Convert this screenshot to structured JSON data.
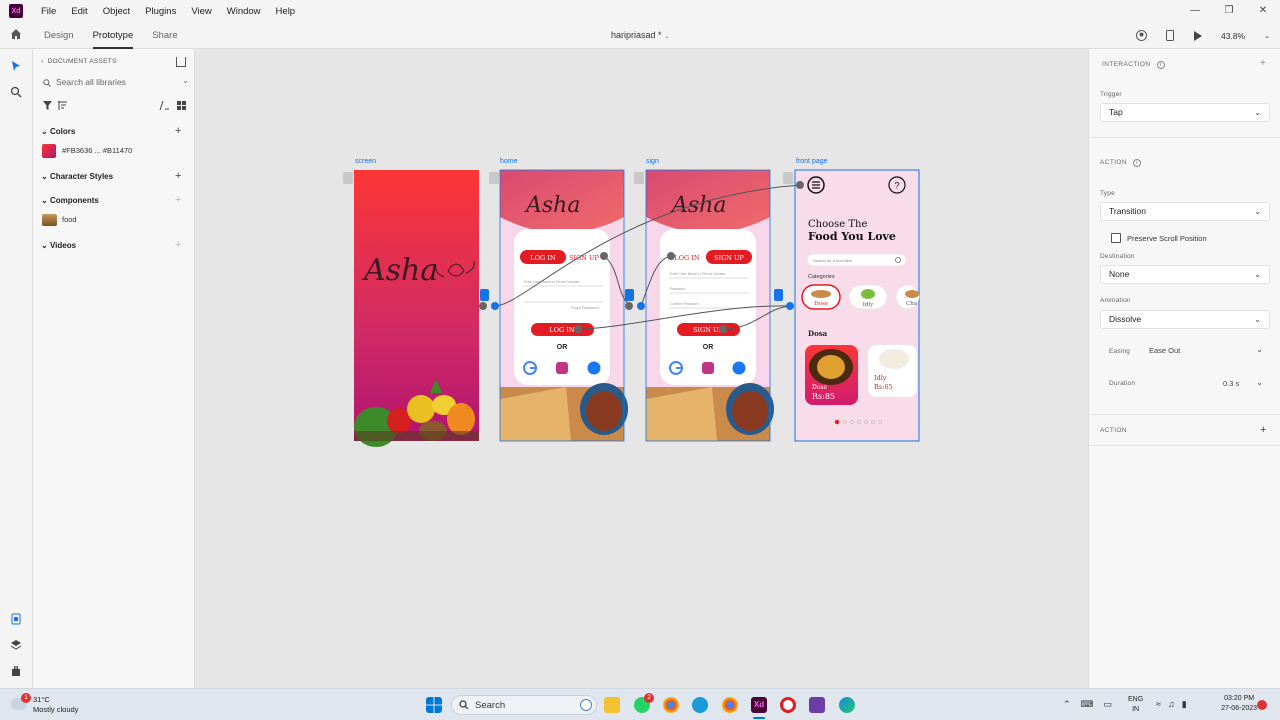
{
  "menu": [
    "File",
    "Edit",
    "Object",
    "Plugins",
    "View",
    "Window",
    "Help"
  ],
  "tabs": {
    "design": "Design",
    "prototype": "Prototype",
    "share": "Share"
  },
  "document": {
    "title": "haripriasad *"
  },
  "zoom": "43.8%",
  "assets": {
    "header": "DOCUMENT ASSETS",
    "search_placeholder": "Search all libraries",
    "colors_label": "Colors",
    "color_swatch_label": "#FB3636 ... #B11470",
    "character_styles_label": "Character Styles",
    "components_label": "Components",
    "component_item": "food",
    "videos_label": "Videos"
  },
  "artboards": [
    {
      "label": "screen"
    },
    {
      "label": "home"
    },
    {
      "label": "sign"
    },
    {
      "label": "front page"
    }
  ],
  "home_screen": {
    "login": "LOG IN",
    "signup": "SIGN UP",
    "field1": "Enter User Name or Phone Number",
    "field2": "Forgot Password?",
    "login_btn": "LOG IN",
    "or": "OR"
  },
  "sign_screen": {
    "login": "LOG IN",
    "signup": "SIGN UP",
    "field1": "Enter User Name or Phone Number",
    "field2": "Password",
    "field3": "Confirm Password",
    "signup_btn": "SIGN UP",
    "or": "OR"
  },
  "front_page": {
    "heading1": "Choose The",
    "heading2": "Food You Love",
    "search_placeholder": "Search for a food item",
    "categories_label": "Categories",
    "categories": [
      "Dose",
      "Idly",
      "Cha"
    ],
    "section_title": "Dosa",
    "card1_name": "Dose",
    "card1_price": "Rs:85",
    "card2_name": "Idly",
    "card2_price": "Rs:65"
  },
  "brand_script": "Asha",
  "interaction": {
    "title": "INTERACTION",
    "trigger_label": "Trigger",
    "trigger_value": "Tap",
    "action_title": "ACTION",
    "type_label": "Type",
    "type_value": "Transition",
    "preserve_scroll": "Preserve Scroll Position",
    "destination_label": "Destination",
    "destination_value": "None",
    "animation_label": "Animation",
    "animation_value": "Dissolve",
    "easing_label": "Easing",
    "easing_value": "Ease Out",
    "duration_label": "Duration",
    "duration_value": "0.3 s",
    "action2_title": "ACTION"
  },
  "taskbar": {
    "temperature": "31°C",
    "weather": "Mostly cloudy",
    "weather_badge": "1",
    "search": "Search",
    "whatsapp_badge": "2",
    "lang1": "ENG",
    "lang2": "IN",
    "time": "03:20 PM",
    "date": "27-06-2023"
  },
  "colors": {
    "accent_blue": "#1473e6",
    "brand_red": "#fb3636",
    "brand_magenta": "#b11470"
  }
}
